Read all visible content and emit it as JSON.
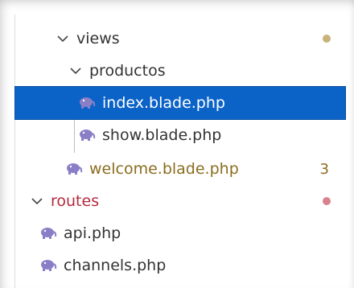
{
  "tree": {
    "items": [
      {
        "label": "views",
        "type": "folder",
        "expanded": true,
        "status": "modified-dot"
      },
      {
        "label": "productos",
        "type": "folder",
        "expanded": true
      },
      {
        "label": "index.blade.php",
        "type": "file",
        "selected": true
      },
      {
        "label": "show.blade.php",
        "type": "file"
      },
      {
        "label": "welcome.blade.php",
        "type": "file",
        "status": "modified",
        "badge": "3"
      },
      {
        "label": "routes",
        "type": "folder",
        "expanded": true,
        "status": "error-dot"
      },
      {
        "label": "api.php",
        "type": "file"
      },
      {
        "label": "channels.php",
        "type": "file"
      }
    ]
  },
  "colors": {
    "selection": "#0b63c8",
    "modified": "#8a6d1f",
    "modified_dot": "#c9b27a",
    "error": "#b52a3c",
    "error_dot": "#d9828e",
    "php_icon": "#8a7fc6"
  },
  "icons": {
    "folder_expanded": "chevron-down-icon",
    "php_file": "php-elephant-icon"
  }
}
